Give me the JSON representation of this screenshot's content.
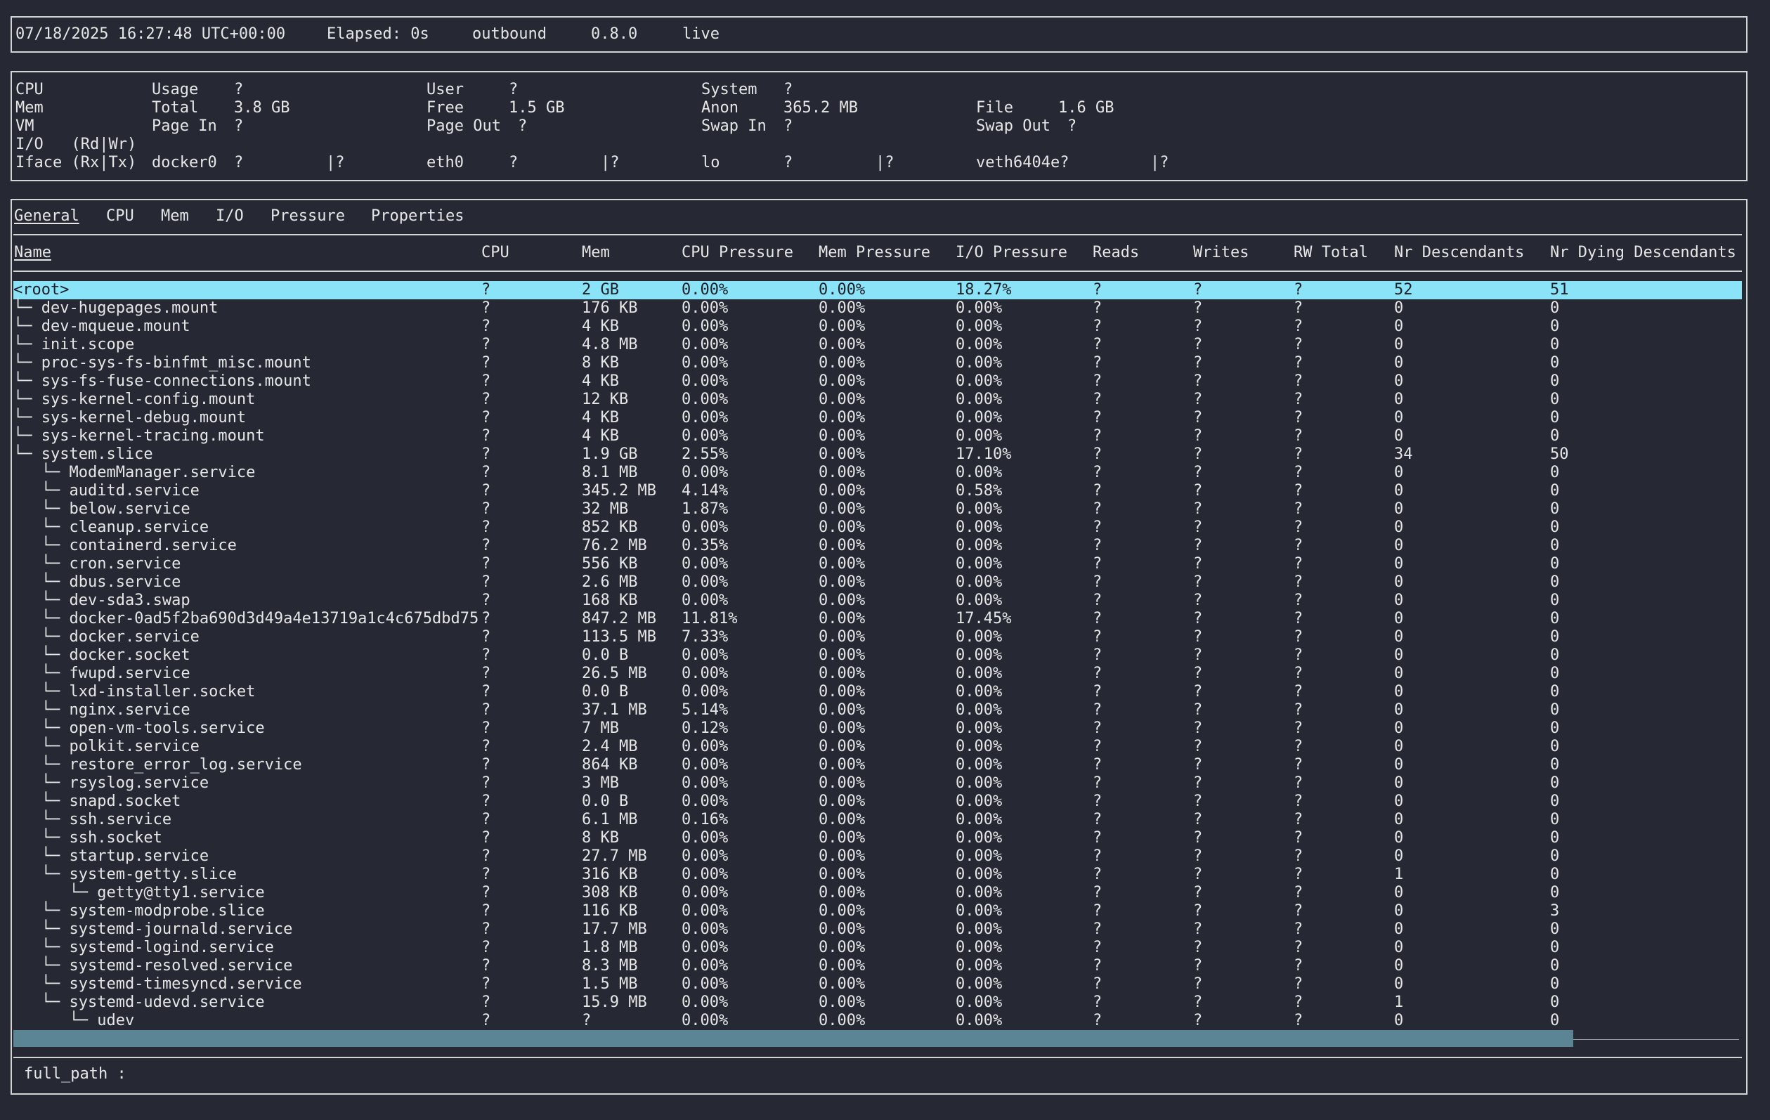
{
  "status_bar": {
    "timestamp": "07/18/2025 16:27:48 UTC+00:00",
    "elapsed": "Elapsed: 0s",
    "mode": "outbound",
    "version": "0.8.0",
    "state": "live"
  },
  "system_summary": {
    "cpu": {
      "label": "CPU",
      "usage_label": "Usage",
      "usage": "?",
      "user_label": "User",
      "user": "?",
      "system_label": "System",
      "system": "?"
    },
    "mem": {
      "label": "Mem",
      "total_label": "Total",
      "total": "3.8 GB",
      "free_label": "Free",
      "free": "1.5 GB",
      "anon_label": "Anon",
      "anon": "365.2 MB",
      "file_label": "File",
      "file": "1.6 GB"
    },
    "vm": {
      "label": "VM",
      "pagein_label": "Page In",
      "pagein": "?",
      "pageout_label": "Page Out",
      "pageout": "?",
      "swapin_label": "Swap In",
      "swapin": "?",
      "swapout_label": "Swap Out",
      "swapout": "?"
    },
    "io": {
      "label": "I/O   (Rd|Wr)"
    },
    "iface": {
      "label": "Iface (Rx|Tx)",
      "items": [
        {
          "name": "docker0",
          "rx": "?",
          "tx": "|?"
        },
        {
          "name": "eth0",
          "rx": "?",
          "tx": "|?"
        },
        {
          "name": "lo",
          "rx": "?",
          "tx": "|?"
        },
        {
          "name": "veth6404e?",
          "rx": "",
          "tx": "|?"
        }
      ]
    }
  },
  "tabs": [
    "General",
    "CPU",
    "Mem",
    "I/O",
    "Pressure",
    "Properties"
  ],
  "active_tab": "General",
  "columns": [
    "Name",
    "CPU",
    "Mem",
    "CPU Pressure",
    "Mem Pressure",
    "I/O Pressure",
    "Reads",
    "Writes",
    "RW Total",
    "Nr Descendants",
    "Nr Dying Descendants"
  ],
  "rows": [
    {
      "name": "<root>",
      "cpu": "?",
      "mem": "2 GB",
      "cpu_p": "0.00%",
      "mem_p": "0.00%",
      "io_p": "18.27%",
      "reads": "?",
      "writes": "?",
      "rw": "?",
      "nr_desc": "52",
      "nr_dying": "51"
    },
    {
      "name": "└─ dev-hugepages.mount",
      "cpu": "?",
      "mem": "176 KB",
      "cpu_p": "0.00%",
      "mem_p": "0.00%",
      "io_p": "0.00%",
      "reads": "?",
      "writes": "?",
      "rw": "?",
      "nr_desc": "0",
      "nr_dying": "0"
    },
    {
      "name": "└─ dev-mqueue.mount",
      "cpu": "?",
      "mem": "4 KB",
      "cpu_p": "0.00%",
      "mem_p": "0.00%",
      "io_p": "0.00%",
      "reads": "?",
      "writes": "?",
      "rw": "?",
      "nr_desc": "0",
      "nr_dying": "0"
    },
    {
      "name": "└─ init.scope",
      "cpu": "?",
      "mem": "4.8 MB",
      "cpu_p": "0.00%",
      "mem_p": "0.00%",
      "io_p": "0.00%",
      "reads": "?",
      "writes": "?",
      "rw": "?",
      "nr_desc": "0",
      "nr_dying": "0"
    },
    {
      "name": "└─ proc-sys-fs-binfmt_misc.mount",
      "cpu": "?",
      "mem": "8 KB",
      "cpu_p": "0.00%",
      "mem_p": "0.00%",
      "io_p": "0.00%",
      "reads": "?",
      "writes": "?",
      "rw": "?",
      "nr_desc": "0",
      "nr_dying": "0"
    },
    {
      "name": "└─ sys-fs-fuse-connections.mount",
      "cpu": "?",
      "mem": "4 KB",
      "cpu_p": "0.00%",
      "mem_p": "0.00%",
      "io_p": "0.00%",
      "reads": "?",
      "writes": "?",
      "rw": "?",
      "nr_desc": "0",
      "nr_dying": "0"
    },
    {
      "name": "└─ sys-kernel-config.mount",
      "cpu": "?",
      "mem": "12 KB",
      "cpu_p": "0.00%",
      "mem_p": "0.00%",
      "io_p": "0.00%",
      "reads": "?",
      "writes": "?",
      "rw": "?",
      "nr_desc": "0",
      "nr_dying": "0"
    },
    {
      "name": "└─ sys-kernel-debug.mount",
      "cpu": "?",
      "mem": "4 KB",
      "cpu_p": "0.00%",
      "mem_p": "0.00%",
      "io_p": "0.00%",
      "reads": "?",
      "writes": "?",
      "rw": "?",
      "nr_desc": "0",
      "nr_dying": "0"
    },
    {
      "name": "└─ sys-kernel-tracing.mount",
      "cpu": "?",
      "mem": "4 KB",
      "cpu_p": "0.00%",
      "mem_p": "0.00%",
      "io_p": "0.00%",
      "reads": "?",
      "writes": "?",
      "rw": "?",
      "nr_desc": "0",
      "nr_dying": "0"
    },
    {
      "name": "└─ system.slice",
      "cpu": "?",
      "mem": "1.9 GB",
      "cpu_p": "2.55%",
      "mem_p": "0.00%",
      "io_p": "17.10%",
      "reads": "?",
      "writes": "?",
      "rw": "?",
      "nr_desc": "34",
      "nr_dying": "50"
    },
    {
      "name": "   └─ ModemManager.service",
      "cpu": "?",
      "mem": "8.1 MB",
      "cpu_p": "0.00%",
      "mem_p": "0.00%",
      "io_p": "0.00%",
      "reads": "?",
      "writes": "?",
      "rw": "?",
      "nr_desc": "0",
      "nr_dying": "0"
    },
    {
      "name": "   └─ auditd.service",
      "cpu": "?",
      "mem": "345.2 MB",
      "cpu_p": "4.14%",
      "mem_p": "0.00%",
      "io_p": "0.58%",
      "reads": "?",
      "writes": "?",
      "rw": "?",
      "nr_desc": "0",
      "nr_dying": "0"
    },
    {
      "name": "   └─ below.service",
      "cpu": "?",
      "mem": "32 MB",
      "cpu_p": "1.87%",
      "mem_p": "0.00%",
      "io_p": "0.00%",
      "reads": "?",
      "writes": "?",
      "rw": "?",
      "nr_desc": "0",
      "nr_dying": "0"
    },
    {
      "name": "   └─ cleanup.service",
      "cpu": "?",
      "mem": "852 KB",
      "cpu_p": "0.00%",
      "mem_p": "0.00%",
      "io_p": "0.00%",
      "reads": "?",
      "writes": "?",
      "rw": "?",
      "nr_desc": "0",
      "nr_dying": "0"
    },
    {
      "name": "   └─ containerd.service",
      "cpu": "?",
      "mem": "76.2 MB",
      "cpu_p": "0.35%",
      "mem_p": "0.00%",
      "io_p": "0.00%",
      "reads": "?",
      "writes": "?",
      "rw": "?",
      "nr_desc": "0",
      "nr_dying": "0"
    },
    {
      "name": "   └─ cron.service",
      "cpu": "?",
      "mem": "556 KB",
      "cpu_p": "0.00%",
      "mem_p": "0.00%",
      "io_p": "0.00%",
      "reads": "?",
      "writes": "?",
      "rw": "?",
      "nr_desc": "0",
      "nr_dying": "0"
    },
    {
      "name": "   └─ dbus.service",
      "cpu": "?",
      "mem": "2.6 MB",
      "cpu_p": "0.00%",
      "mem_p": "0.00%",
      "io_p": "0.00%",
      "reads": "?",
      "writes": "?",
      "rw": "?",
      "nr_desc": "0",
      "nr_dying": "0"
    },
    {
      "name": "   └─ dev-sda3.swap",
      "cpu": "?",
      "mem": "168 KB",
      "cpu_p": "0.00%",
      "mem_p": "0.00%",
      "io_p": "0.00%",
      "reads": "?",
      "writes": "?",
      "rw": "?",
      "nr_desc": "0",
      "nr_dying": "0"
    },
    {
      "name": "   └─ docker-0ad5f2ba690d3d49a4e13719a1c4c675dbd75",
      "cpu": "?",
      "mem": "847.2 MB",
      "cpu_p": "11.81%",
      "mem_p": "0.00%",
      "io_p": "17.45%",
      "reads": "?",
      "writes": "?",
      "rw": "?",
      "nr_desc": "0",
      "nr_dying": "0"
    },
    {
      "name": "   └─ docker.service",
      "cpu": "?",
      "mem": "113.5 MB",
      "cpu_p": "7.33%",
      "mem_p": "0.00%",
      "io_p": "0.00%",
      "reads": "?",
      "writes": "?",
      "rw": "?",
      "nr_desc": "0",
      "nr_dying": "0"
    },
    {
      "name": "   └─ docker.socket",
      "cpu": "?",
      "mem": "0.0 B",
      "cpu_p": "0.00%",
      "mem_p": "0.00%",
      "io_p": "0.00%",
      "reads": "?",
      "writes": "?",
      "rw": "?",
      "nr_desc": "0",
      "nr_dying": "0"
    },
    {
      "name": "   └─ fwupd.service",
      "cpu": "?",
      "mem": "26.5 MB",
      "cpu_p": "0.00%",
      "mem_p": "0.00%",
      "io_p": "0.00%",
      "reads": "?",
      "writes": "?",
      "rw": "?",
      "nr_desc": "0",
      "nr_dying": "0"
    },
    {
      "name": "   └─ lxd-installer.socket",
      "cpu": "?",
      "mem": "0.0 B",
      "cpu_p": "0.00%",
      "mem_p": "0.00%",
      "io_p": "0.00%",
      "reads": "?",
      "writes": "?",
      "rw": "?",
      "nr_desc": "0",
      "nr_dying": "0"
    },
    {
      "name": "   └─ nginx.service",
      "cpu": "?",
      "mem": "37.1 MB",
      "cpu_p": "5.14%",
      "mem_p": "0.00%",
      "io_p": "0.00%",
      "reads": "?",
      "writes": "?",
      "rw": "?",
      "nr_desc": "0",
      "nr_dying": "0"
    },
    {
      "name": "   └─ open-vm-tools.service",
      "cpu": "?",
      "mem": "7 MB",
      "cpu_p": "0.12%",
      "mem_p": "0.00%",
      "io_p": "0.00%",
      "reads": "?",
      "writes": "?",
      "rw": "?",
      "nr_desc": "0",
      "nr_dying": "0"
    },
    {
      "name": "   └─ polkit.service",
      "cpu": "?",
      "mem": "2.4 MB",
      "cpu_p": "0.00%",
      "mem_p": "0.00%",
      "io_p": "0.00%",
      "reads": "?",
      "writes": "?",
      "rw": "?",
      "nr_desc": "0",
      "nr_dying": "0"
    },
    {
      "name": "   └─ restore_error_log.service",
      "cpu": "?",
      "mem": "864 KB",
      "cpu_p": "0.00%",
      "mem_p": "0.00%",
      "io_p": "0.00%",
      "reads": "?",
      "writes": "?",
      "rw": "?",
      "nr_desc": "0",
      "nr_dying": "0"
    },
    {
      "name": "   └─ rsyslog.service",
      "cpu": "?",
      "mem": "3 MB",
      "cpu_p": "0.00%",
      "mem_p": "0.00%",
      "io_p": "0.00%",
      "reads": "?",
      "writes": "?",
      "rw": "?",
      "nr_desc": "0",
      "nr_dying": "0"
    },
    {
      "name": "   └─ snapd.socket",
      "cpu": "?",
      "mem": "0.0 B",
      "cpu_p": "0.00%",
      "mem_p": "0.00%",
      "io_p": "0.00%",
      "reads": "?",
      "writes": "?",
      "rw": "?",
      "nr_desc": "0",
      "nr_dying": "0"
    },
    {
      "name": "   └─ ssh.service",
      "cpu": "?",
      "mem": "6.1 MB",
      "cpu_p": "0.16%",
      "mem_p": "0.00%",
      "io_p": "0.00%",
      "reads": "?",
      "writes": "?",
      "rw": "?",
      "nr_desc": "0",
      "nr_dying": "0"
    },
    {
      "name": "   └─ ssh.socket",
      "cpu": "?",
      "mem": "8 KB",
      "cpu_p": "0.00%",
      "mem_p": "0.00%",
      "io_p": "0.00%",
      "reads": "?",
      "writes": "?",
      "rw": "?",
      "nr_desc": "0",
      "nr_dying": "0"
    },
    {
      "name": "   └─ startup.service",
      "cpu": "?",
      "mem": "27.7 MB",
      "cpu_p": "0.00%",
      "mem_p": "0.00%",
      "io_p": "0.00%",
      "reads": "?",
      "writes": "?",
      "rw": "?",
      "nr_desc": "0",
      "nr_dying": "0"
    },
    {
      "name": "   └─ system-getty.slice",
      "cpu": "?",
      "mem": "316 KB",
      "cpu_p": "0.00%",
      "mem_p": "0.00%",
      "io_p": "0.00%",
      "reads": "?",
      "writes": "?",
      "rw": "?",
      "nr_desc": "1",
      "nr_dying": "0"
    },
    {
      "name": "      └─ getty@tty1.service",
      "cpu": "?",
      "mem": "308 KB",
      "cpu_p": "0.00%",
      "mem_p": "0.00%",
      "io_p": "0.00%",
      "reads": "?",
      "writes": "?",
      "rw": "?",
      "nr_desc": "0",
      "nr_dying": "0"
    },
    {
      "name": "   └─ system-modprobe.slice",
      "cpu": "?",
      "mem": "116 KB",
      "cpu_p": "0.00%",
      "mem_p": "0.00%",
      "io_p": "0.00%",
      "reads": "?",
      "writes": "?",
      "rw": "?",
      "nr_desc": "0",
      "nr_dying": "3"
    },
    {
      "name": "   └─ systemd-journald.service",
      "cpu": "?",
      "mem": "17.7 MB",
      "cpu_p": "0.00%",
      "mem_p": "0.00%",
      "io_p": "0.00%",
      "reads": "?",
      "writes": "?",
      "rw": "?",
      "nr_desc": "0",
      "nr_dying": "0"
    },
    {
      "name": "   └─ systemd-logind.service",
      "cpu": "?",
      "mem": "1.8 MB",
      "cpu_p": "0.00%",
      "mem_p": "0.00%",
      "io_p": "0.00%",
      "reads": "?",
      "writes": "?",
      "rw": "?",
      "nr_desc": "0",
      "nr_dying": "0"
    },
    {
      "name": "   └─ systemd-resolved.service",
      "cpu": "?",
      "mem": "8.3 MB",
      "cpu_p": "0.00%",
      "mem_p": "0.00%",
      "io_p": "0.00%",
      "reads": "?",
      "writes": "?",
      "rw": "?",
      "nr_desc": "0",
      "nr_dying": "0"
    },
    {
      "name": "   └─ systemd-timesyncd.service",
      "cpu": "?",
      "mem": "1.5 MB",
      "cpu_p": "0.00%",
      "mem_p": "0.00%",
      "io_p": "0.00%",
      "reads": "?",
      "writes": "?",
      "rw": "?",
      "nr_desc": "0",
      "nr_dying": "0"
    },
    {
      "name": "   └─ systemd-udevd.service",
      "cpu": "?",
      "mem": "15.9 MB",
      "cpu_p": "0.00%",
      "mem_p": "0.00%",
      "io_p": "0.00%",
      "reads": "?",
      "writes": "?",
      "rw": "?",
      "nr_desc": "1",
      "nr_dying": "0"
    },
    {
      "name": "      └─ udev",
      "cpu": "?",
      "mem": "?",
      "cpu_p": "0.00%",
      "mem_p": "0.00%",
      "io_p": "0.00%",
      "reads": "?",
      "writes": "?",
      "rw": "?",
      "nr_desc": "0",
      "nr_dying": "0"
    }
  ],
  "selected_row": 0,
  "scrollbar": {
    "thumb_fraction": 0.904
  },
  "footer": {
    "full_path_label": "full_path :",
    "full_path_value": ""
  },
  "colors": {
    "background": "#262833",
    "foreground": "#e6e6e6",
    "selection": "#8be3f7",
    "scrollbar_thumb": "#5b8594"
  }
}
